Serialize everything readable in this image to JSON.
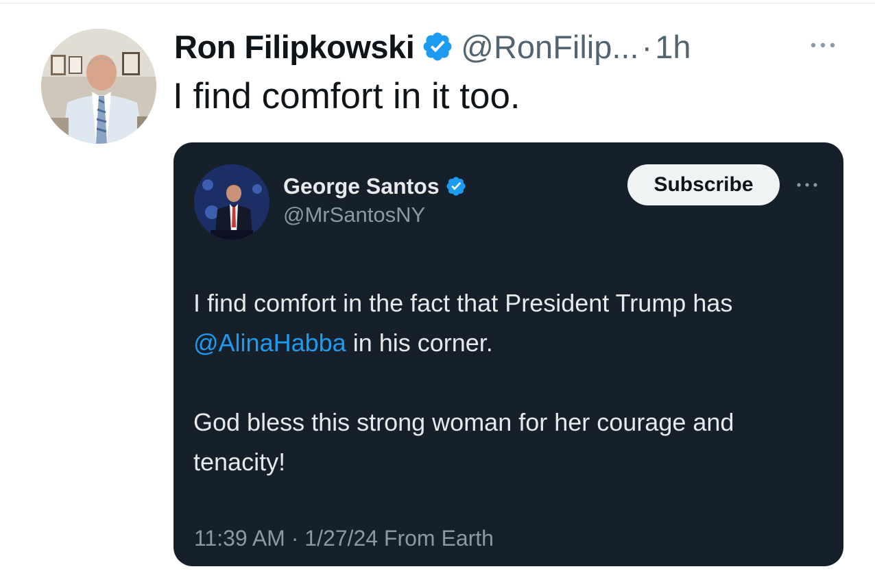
{
  "post": {
    "author": {
      "display_name": "Ron Filipkowski",
      "handle": "@RonFilip...",
      "verified": true
    },
    "separator": "·",
    "time": "1h",
    "text": "I find comfort in it too."
  },
  "quoted_post": {
    "author": {
      "display_name": "George Santos",
      "handle": "@MrSantosNY",
      "verified": true
    },
    "subscribe_label": "Subscribe",
    "body": {
      "line1_before": "I find comfort in the fact that President Trump has ",
      "mention": "@AlinaHabba",
      "line1_after": " in his corner.",
      "paragraph2": "God bless this strong woman for her courage and tenacity!"
    },
    "meta": "11:39 AM · 1/27/24 From Earth"
  },
  "colors": {
    "verified_badge": "#1d9bf0",
    "mention_link": "#1d9bf0",
    "embed_background": "#16202b"
  },
  "icons": {
    "verified": "verified-badge-icon",
    "more": "more-horizontal-icon"
  }
}
